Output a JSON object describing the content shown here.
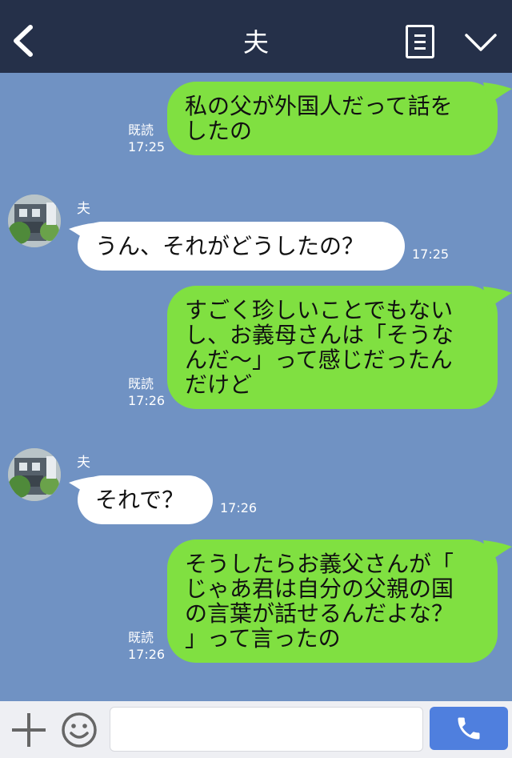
{
  "header": {
    "title": "夫",
    "back_icon": "chevron-left-icon",
    "notes_icon": "notes-icon",
    "menu_icon": "chevron-down-icon"
  },
  "messages": [
    {
      "side": "right",
      "text_lines": [
        "私の父が外国人だって話を",
        "したの"
      ],
      "read": "既読",
      "time": "17:25"
    },
    {
      "side": "left",
      "sender": "夫",
      "text": "うん、それがどうしたの？",
      "time": "17:25"
    },
    {
      "side": "right",
      "text_lines": [
        "すごく珍しいことでもない",
        "し、お義母さんは「そうな",
        "んだ～」って感じだったん",
        "だけど"
      ],
      "read": "既読",
      "time": "17:26"
    },
    {
      "side": "left",
      "sender": "夫",
      "text": "それで？",
      "time": "17:26"
    },
    {
      "side": "right",
      "text_lines": [
        "そうしたらお義父さんが「",
        "じゃあ君は自分の父親の国",
        "の言葉が話せるんだよな？",
        "」って言ったの"
      ],
      "read": "既読",
      "time": "17:26"
    }
  ],
  "footer": {
    "input_value": "",
    "plus_icon": "plus-icon",
    "emoji_icon": "smiley-icon",
    "call_icon": "phone-icon"
  },
  "colors": {
    "header_bg": "#253049",
    "chat_bg": "#7092c3",
    "bubble_green": "#80e041",
    "bubble_white": "#ffffff",
    "call_button": "#4f7fde"
  }
}
